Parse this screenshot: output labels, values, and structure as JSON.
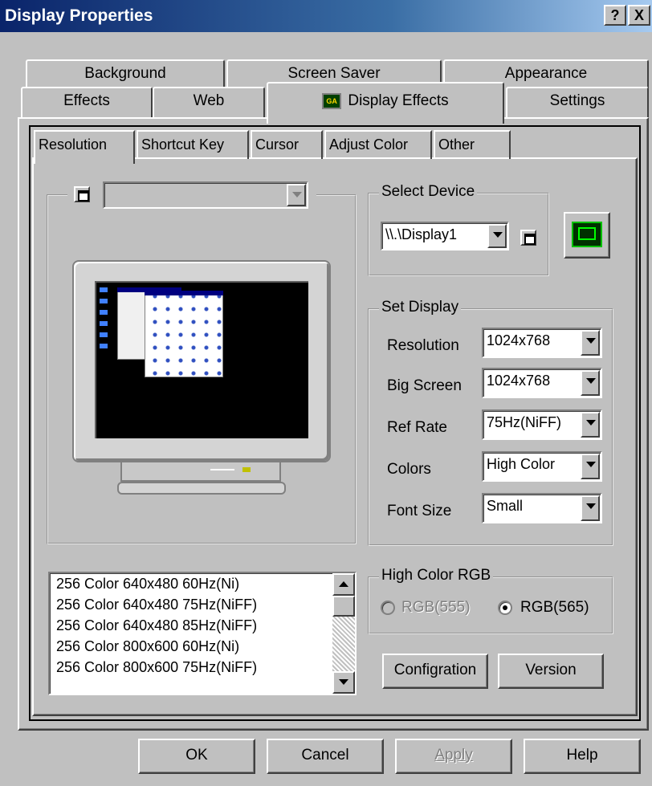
{
  "window": {
    "title": "Display Properties",
    "help_button": "?",
    "close_button": "X"
  },
  "tabs_row1": [
    "Background",
    "Screen Saver",
    "Appearance"
  ],
  "tabs_row2": [
    "Effects",
    "Web",
    "Display Effects",
    "Settings"
  ],
  "selected_tab": "Display Effects",
  "subtabs": [
    "Resolution",
    "Shortcut Key",
    "Cursor",
    "Adjust Color",
    "Other"
  ],
  "selected_subtab": "Resolution",
  "monitor_group": {
    "combo_value": ""
  },
  "select_device": {
    "label": "Select Device",
    "value": "\\\\.\\Display1"
  },
  "set_display": {
    "label": "Set Display",
    "rows": [
      {
        "label": "Resolution",
        "value": "1024x768"
      },
      {
        "label": "Big Screen",
        "value": "1024x768"
      },
      {
        "label": "Ref Rate",
        "value": "75Hz(NiFF)"
      },
      {
        "label": "Colors",
        "value": "High Color"
      },
      {
        "label": "Font Size",
        "value": "Small"
      }
    ]
  },
  "modes_list": [
    "256 Color 640x480 60Hz(Ni)",
    "256 Color 640x480 75Hz(NiFF)",
    "256 Color 640x480 85Hz(NiFF)",
    "256 Color 800x600 60Hz(Ni)",
    "256 Color 800x600 75Hz(NiFF)"
  ],
  "high_color_rgb": {
    "label": "High Color RGB",
    "option1": "RGB(555)",
    "option2": "RGB(565)",
    "selected": "RGB(565)"
  },
  "buttons": {
    "configuration": "Configration",
    "version": "Version",
    "ok": "OK",
    "cancel": "Cancel",
    "apply": "Apply",
    "help": "Help"
  },
  "colors": {
    "titlebar_start": "#0a246a",
    "titlebar_end": "#a6caf0",
    "face": "#c0c0c0",
    "accent_green": "#00c000"
  }
}
